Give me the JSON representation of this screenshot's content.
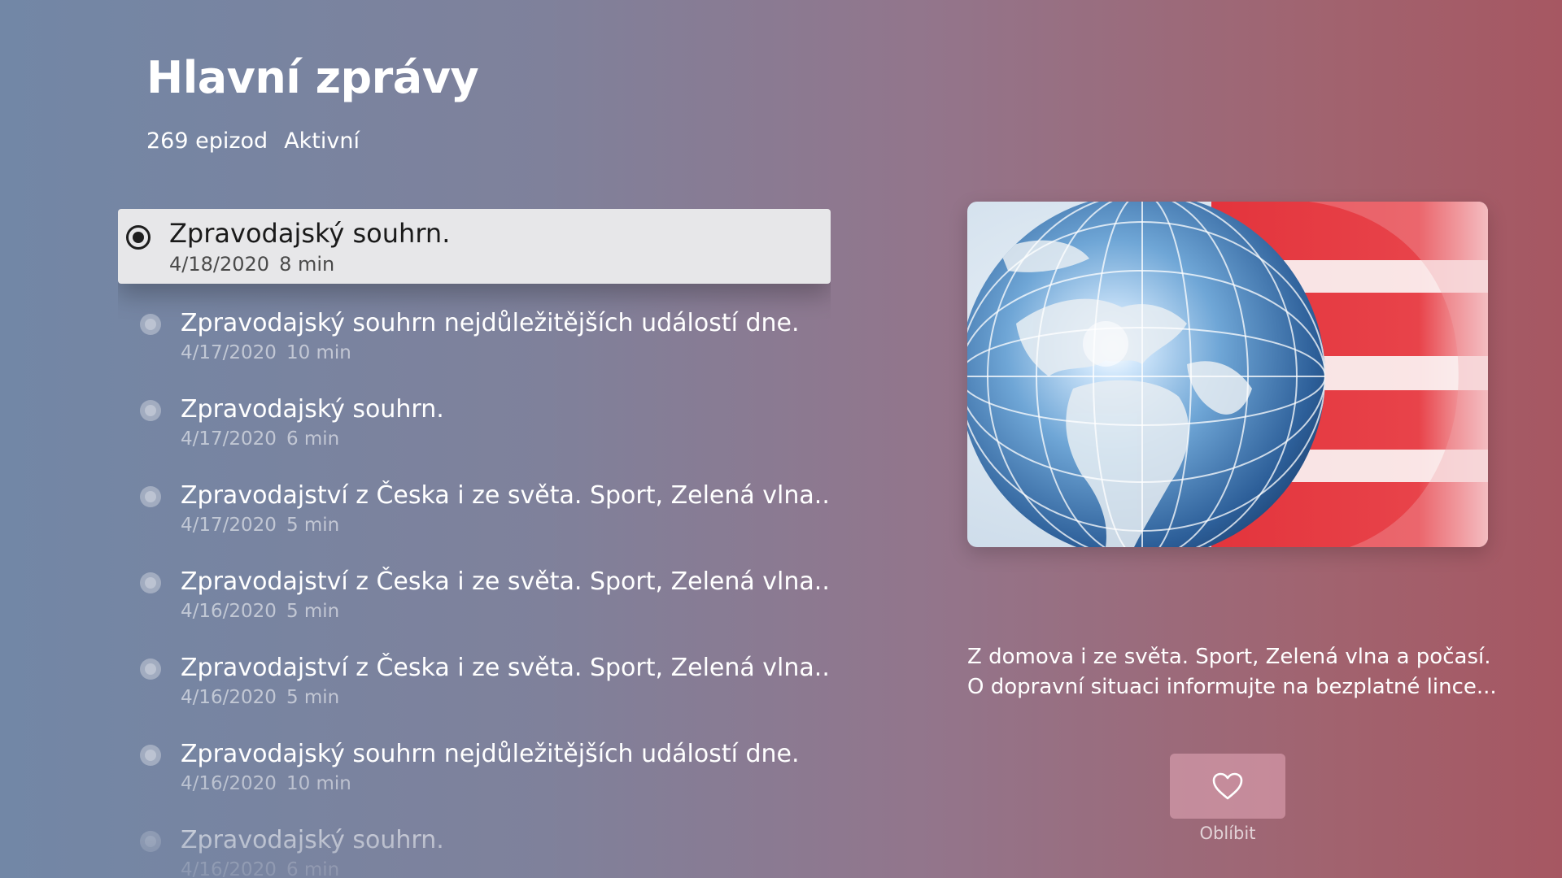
{
  "header": {
    "title": "Hlavní zprávy",
    "episode_count": "269 epizod",
    "status": "Aktivní"
  },
  "episodes": [
    {
      "title": "Zpravodajský souhrn.",
      "date": "4/18/2020",
      "duration": "8 min",
      "focused": true
    },
    {
      "title": "Zpravodajský souhrn nejdůležitějších událostí dne.",
      "date": "4/17/2020",
      "duration": "10 min"
    },
    {
      "title": "Zpravodajský souhrn.",
      "date": "4/17/2020",
      "duration": "6 min"
    },
    {
      "title": "Zpravodajství z Česka i ze světa. Sport, Zelená vlna...",
      "date": "4/17/2020",
      "duration": "5 min"
    },
    {
      "title": "Zpravodajství z Česka i ze světa. Sport, Zelená vlna...",
      "date": "4/16/2020",
      "duration": "5 min"
    },
    {
      "title": "Zpravodajství z Česka i ze světa. Sport, Zelená vlna...",
      "date": "4/16/2020",
      "duration": "5 min"
    },
    {
      "title": "Zpravodajský souhrn nejdůležitějších událostí dne.",
      "date": "4/16/2020",
      "duration": "10 min"
    },
    {
      "title": "Zpravodajský souhrn.",
      "date": "4/16/2020",
      "duration": "6 min"
    }
  ],
  "detail": {
    "description_line1": "Z domova i ze světa. Sport, Zelená vlna a počasí.",
    "description_line2": "O dopravní situaci informujte na bezplatné lince...",
    "favorite_label": "Oblíbit",
    "favorite_icon": "heart-outline-icon"
  },
  "colors": {
    "background_left": "#7287a6",
    "background_right": "#a65762",
    "focused_row": "#e7e7e9",
    "artwork_red": "#e3343c"
  }
}
